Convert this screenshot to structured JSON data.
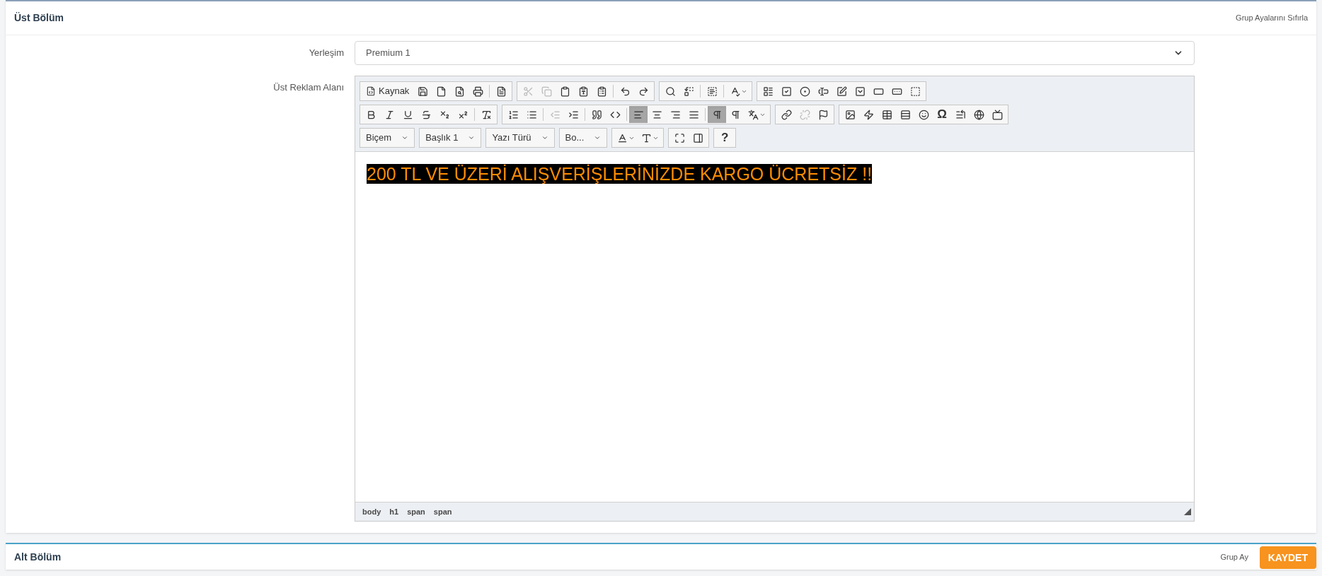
{
  "top_section": {
    "title": "Üst Bölüm",
    "reset_link": "Grup Ayalarını Sıfırla"
  },
  "fields": [
    {
      "label": "Yerleşim",
      "kind": "select",
      "value": "Premium 1"
    },
    {
      "label": "Üst Reklam Alanı",
      "kind": "editor"
    }
  ],
  "toolbar": [
    [
      [
        {
          "kind": "source",
          "label": "Kaynak"
        },
        {
          "kind": "icon",
          "disabled": false,
          "selected": false
        },
        {
          "kind": "icon",
          "disabled": false,
          "selected": false
        },
        {
          "kind": "icon",
          "disabled": false,
          "selected": false
        },
        {
          "kind": "icon",
          "disabled": false,
          "selected": false
        },
        {
          "kind": "sep"
        },
        {
          "kind": "icon",
          "disabled": false,
          "selected": false
        }
      ],
      [
        {
          "kind": "icon",
          "disabled": true,
          "selected": false
        },
        {
          "kind": "icon",
          "disabled": true,
          "selected": false
        },
        {
          "kind": "icon",
          "disabled": false,
          "selected": false
        },
        {
          "kind": "icon",
          "disabled": false,
          "selected": false
        },
        {
          "kind": "icon",
          "disabled": false,
          "selected": false
        },
        {
          "kind": "sep"
        },
        {
          "kind": "icon",
          "disabled": false,
          "selected": false
        },
        {
          "kind": "icon",
          "disabled": false,
          "selected": false
        }
      ],
      [
        {
          "kind": "icon",
          "disabled": false,
          "selected": false
        },
        {
          "kind": "icon",
          "disabled": false,
          "selected": false
        },
        {
          "kind": "sep"
        },
        {
          "kind": "icon",
          "disabled": false,
          "selected": false
        },
        {
          "kind": "sep"
        },
        {
          "kind": "menu"
        }
      ],
      [
        {
          "kind": "icon",
          "disabled": false,
          "selected": false
        },
        {
          "kind": "icon",
          "disabled": false,
          "selected": false
        },
        {
          "kind": "icon",
          "disabled": false,
          "selected": false
        },
        {
          "kind": "icon",
          "disabled": false,
          "selected": false
        },
        {
          "kind": "icon",
          "disabled": false,
          "selected": false
        },
        {
          "kind": "icon",
          "disabled": false,
          "selected": false
        },
        {
          "kind": "icon",
          "disabled": false,
          "selected": false
        },
        {
          "kind": "icon",
          "disabled": false,
          "selected": false
        },
        {
          "kind": "icon",
          "disabled": false,
          "selected": false
        }
      ]
    ],
    [
      [
        {
          "kind": "icon",
          "disabled": false,
          "selected": false
        },
        {
          "kind": "icon",
          "disabled": false,
          "selected": false
        },
        {
          "kind": "icon",
          "disabled": false,
          "selected": false
        },
        {
          "kind": "icon",
          "disabled": false,
          "selected": false
        },
        {
          "kind": "icon",
          "disabled": false,
          "selected": false
        },
        {
          "kind": "icon",
          "disabled": false,
          "selected": false
        },
        {
          "kind": "sep"
        },
        {
          "kind": "icon",
          "disabled": false,
          "selected": false
        }
      ],
      [
        {
          "kind": "icon",
          "disabled": false,
          "selected": false
        },
        {
          "kind": "icon",
          "disabled": false,
          "selected": false
        },
        {
          "kind": "sep"
        },
        {
          "kind": "icon",
          "disabled": true,
          "selected": false
        },
        {
          "kind": "icon",
          "disabled": false,
          "selected": false
        },
        {
          "kind": "sep"
        },
        {
          "kind": "icon",
          "disabled": false,
          "selected": false
        },
        {
          "kind": "icon",
          "disabled": false,
          "selected": false
        },
        {
          "kind": "sep"
        },
        {
          "kind": "icon",
          "disabled": false,
          "selected": true
        },
        {
          "kind": "icon",
          "disabled": false,
          "selected": false
        },
        {
          "kind": "icon",
          "disabled": false,
          "selected": false
        },
        {
          "kind": "icon",
          "disabled": false,
          "selected": false
        },
        {
          "kind": "sep"
        },
        {
          "kind": "icon",
          "disabled": false,
          "selected": true
        },
        {
          "kind": "icon",
          "disabled": false,
          "selected": false
        },
        {
          "kind": "menu"
        }
      ],
      [
        {
          "kind": "icon",
          "disabled": false,
          "selected": false
        },
        {
          "kind": "icon",
          "disabled": true,
          "selected": false
        },
        {
          "kind": "icon",
          "disabled": false,
          "selected": false
        }
      ],
      [
        {
          "kind": "icon",
          "disabled": false,
          "selected": false
        },
        {
          "kind": "icon",
          "disabled": false,
          "selected": false
        },
        {
          "kind": "icon",
          "disabled": false,
          "selected": false
        },
        {
          "kind": "icon",
          "disabled": false,
          "selected": false
        },
        {
          "kind": "icon",
          "disabled": false,
          "selected": false
        },
        {
          "kind": "glyph",
          "label": "Ω"
        },
        {
          "kind": "icon",
          "disabled": false,
          "selected": false
        },
        {
          "kind": "icon",
          "disabled": false,
          "selected": false
        },
        {
          "kind": "icon",
          "disabled": false,
          "selected": false
        }
      ]
    ],
    [
      [
        {
          "kind": "combo",
          "label": "Biçem"
        }
      ],
      [
        {
          "kind": "combo",
          "label": "Başlık 1"
        }
      ],
      [
        {
          "kind": "combo",
          "label": "Yazı Türü"
        }
      ],
      [
        {
          "kind": "combo",
          "label": "Bo..."
        }
      ],
      [
        {
          "kind": "menu"
        },
        {
          "kind": "menu"
        }
      ],
      [
        {
          "kind": "icon",
          "disabled": false,
          "selected": false
        },
        {
          "kind": "icon",
          "disabled": false,
          "selected": false
        }
      ],
      [
        {
          "kind": "glyph",
          "label": "?"
        }
      ]
    ]
  ],
  "content": {
    "text": "200 TL VE ÜZERİ ALIŞVERİŞLERİNİZDE KARGO ÜCRETSİZ !!"
  },
  "path": [
    "body",
    "h1",
    "span",
    "span"
  ],
  "bottom_section": {
    "title": "Alt Bölüm",
    "reset_link": "Grup Ay"
  },
  "save_button": "KAYDET"
}
